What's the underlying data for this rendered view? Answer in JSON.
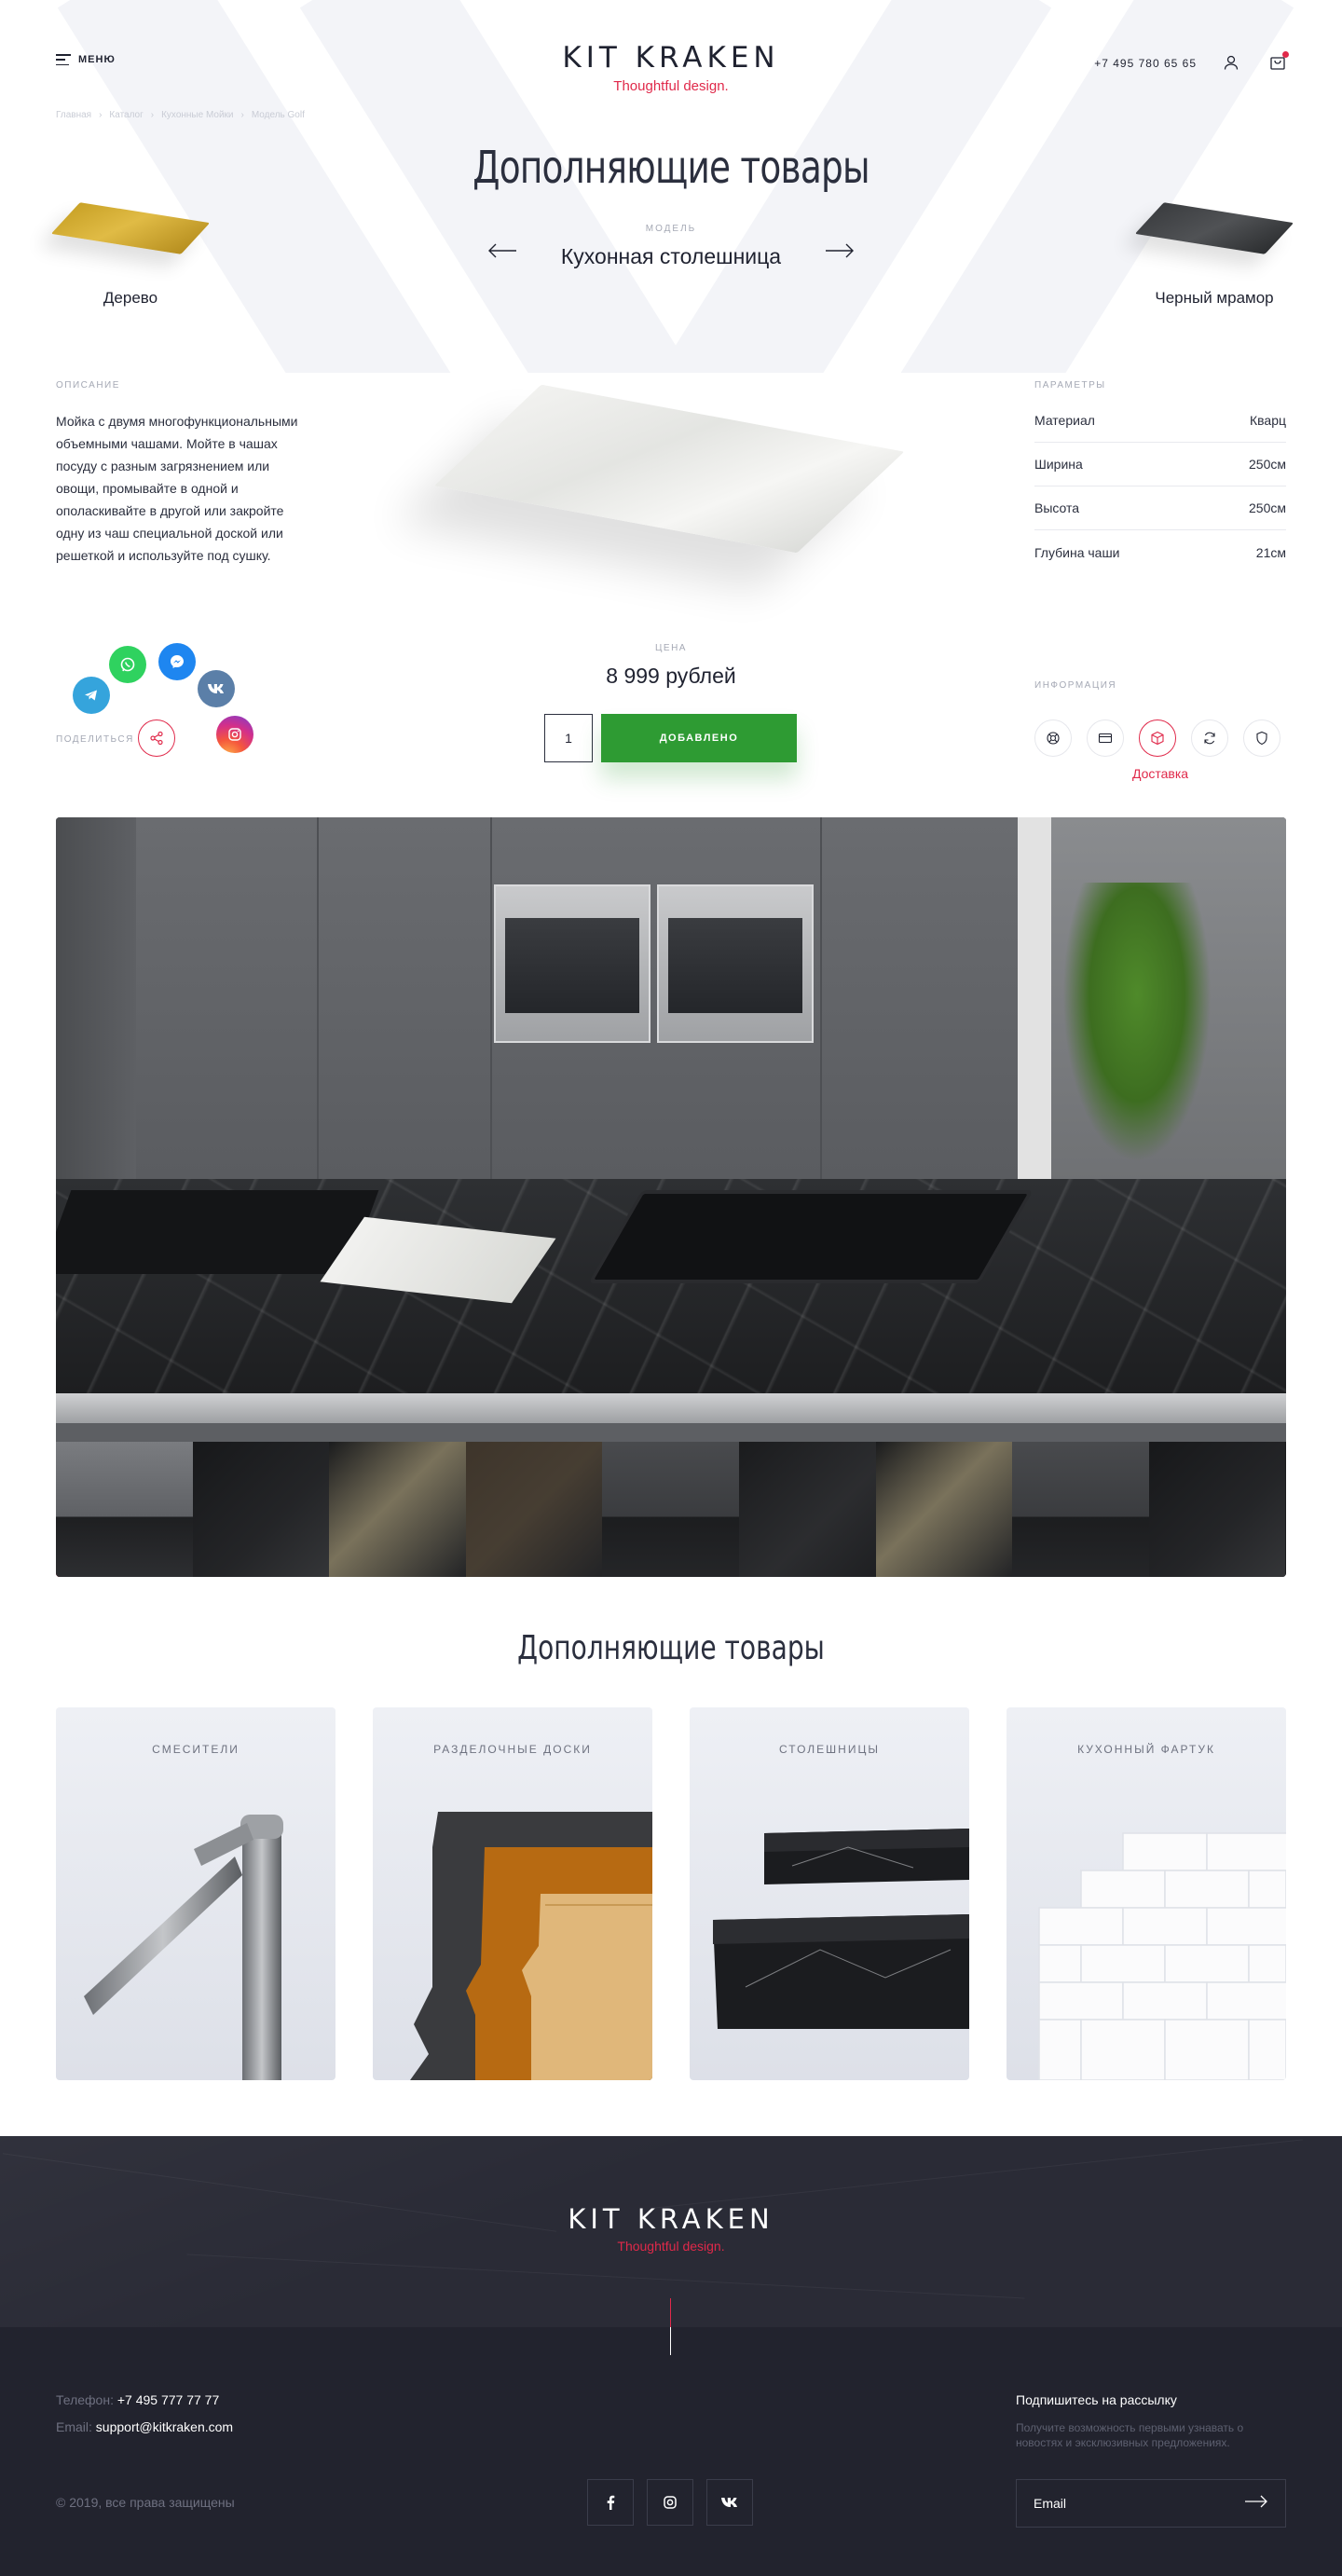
{
  "header": {
    "menu_label": "МЕНЮ",
    "logo_text": "KIT KRAKEN",
    "logo_tagline": "Thoughtful design.",
    "phone": "+7 495 780 65 65"
  },
  "breadcrumb": [
    "Главная",
    "Каталог",
    "Кухонные Мойки",
    "Модель Golf"
  ],
  "page_title": "Дополняющие товары",
  "model": {
    "label": "МОДЕЛЬ",
    "name": "Кухонная столешница",
    "prev": {
      "name": "Дерево"
    },
    "next": {
      "name": "Черный мрамор"
    }
  },
  "description": {
    "label": "ОПИСАНИЕ",
    "text": "Мойка с двумя многофункциональными объемными чашами. Мойте в чашах посуду с разным загрязнением или овощи,  промывайте в одной и ополаскивайте в другой или закройте одну из чаш специальной доской или решеткой и используйте под сушку."
  },
  "parameters": {
    "label": "ПАРАМЕТРЫ",
    "rows": [
      {
        "name": "Материал",
        "value": "Кварц"
      },
      {
        "name": "Ширина",
        "value": "250см"
      },
      {
        "name": "Высота",
        "value": "250см"
      },
      {
        "name": "Глубина чаши",
        "value": "21см"
      }
    ]
  },
  "price": {
    "label": "ЦЕНА",
    "value": "8 999 рублей",
    "quantity": "1",
    "button_label": "ДОБАВЛЕНО"
  },
  "share": {
    "label": "ПОДЕЛИТЬСЯ"
  },
  "info": {
    "label": "ИНФОРМАЦИЯ",
    "active_caption": "Доставка",
    "icons": [
      "support-icon",
      "card-icon",
      "box-icon",
      "refresh-icon",
      "shield-icon"
    ]
  },
  "gallery": {
    "thumb_count": 9,
    "active_index": 0
  },
  "related": {
    "title": "Дополняющие товары",
    "cards": [
      {
        "title": "СМЕСИТЕЛИ"
      },
      {
        "title": "РАЗДЕЛОЧНЫЕ ДОСКИ"
      },
      {
        "title": "СТОЛЕШНИЦЫ"
      },
      {
        "title": "КУХОННЫЙ ФАРТУК"
      }
    ]
  },
  "footer": {
    "logo_text": "KIT KRAKEN",
    "logo_tagline": "Thoughtful design.",
    "phone_label": "Телефон: ",
    "phone": "+7 495 777 77 77",
    "email_label": "Email: ",
    "email": "support@kitkraken.com",
    "copyright": "© 2019, все права защищены",
    "subscribe_title": "Подпишитесь на рассылку",
    "subscribe_text": "Получите возможность первыми узнавать о новостях и эксклюзивных предложениях.",
    "email_placeholder": "Email"
  },
  "colors": {
    "accent": "#e0294a",
    "button_green": "#2e9b33",
    "footer_dark": "#22232e",
    "text_dark": "#1f2230"
  }
}
